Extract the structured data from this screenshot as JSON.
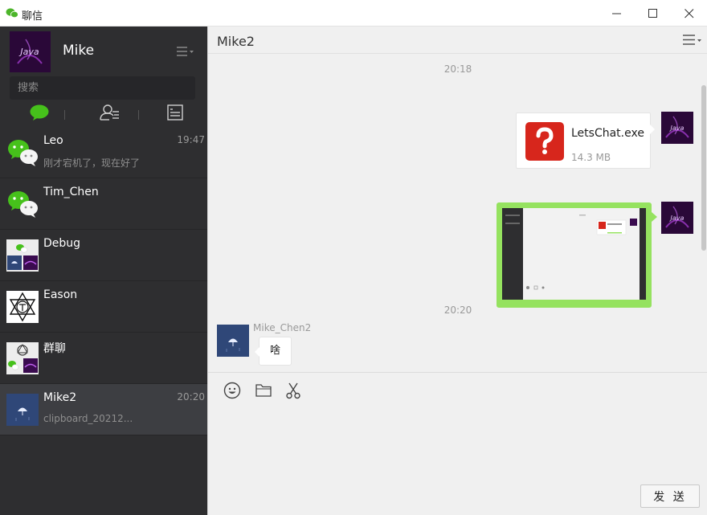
{
  "window": {
    "title": "聊信",
    "app_icon": "wechat-icon",
    "controls": [
      "minimize-icon",
      "maximize-icon",
      "close-icon"
    ]
  },
  "profile": {
    "name": "Mike",
    "avatar_text": "Java"
  },
  "search": {
    "placeholder": "搜索"
  },
  "nav": {
    "tabs": [
      "chat-bubble-icon",
      "contacts-icon",
      "favorites-icon"
    ],
    "active_color": "#46c11b"
  },
  "chats": [
    {
      "name": "Leo",
      "time": "19:47",
      "preview": "刚才宕机了，现在好了",
      "avatar": "wechat"
    },
    {
      "name": "Tim_Chen",
      "time": "",
      "preview": "",
      "avatar": "wechat"
    },
    {
      "name": "Debug",
      "time": "",
      "preview": "",
      "avatar": "group"
    },
    {
      "name": "Eason",
      "time": "",
      "preview": "",
      "avatar": "geometric"
    },
    {
      "name": "群聊",
      "time": "",
      "preview": "",
      "avatar": "group"
    },
    {
      "name": "Mike2",
      "time": "20:20",
      "preview": "clipboard_20212...",
      "avatar": "umbrella",
      "active": true
    }
  ],
  "conversation": {
    "title": "Mike2",
    "timestamps": [
      "20:18",
      "20:20"
    ],
    "file_message": {
      "name": "LetsChat.exe",
      "size": "14.3 MB"
    },
    "text_message": {
      "sender": "Mike_Chen2",
      "text": "啥"
    }
  },
  "composer": {
    "tools": [
      "emoji-icon",
      "folder-icon",
      "scissors-icon"
    ],
    "send_label": "发 送"
  },
  "colors": {
    "sidebar_bg": "#2e2e30",
    "image_bubble": "#95e25f",
    "file_icon": "#d7261c",
    "accent": "#46c11b"
  }
}
